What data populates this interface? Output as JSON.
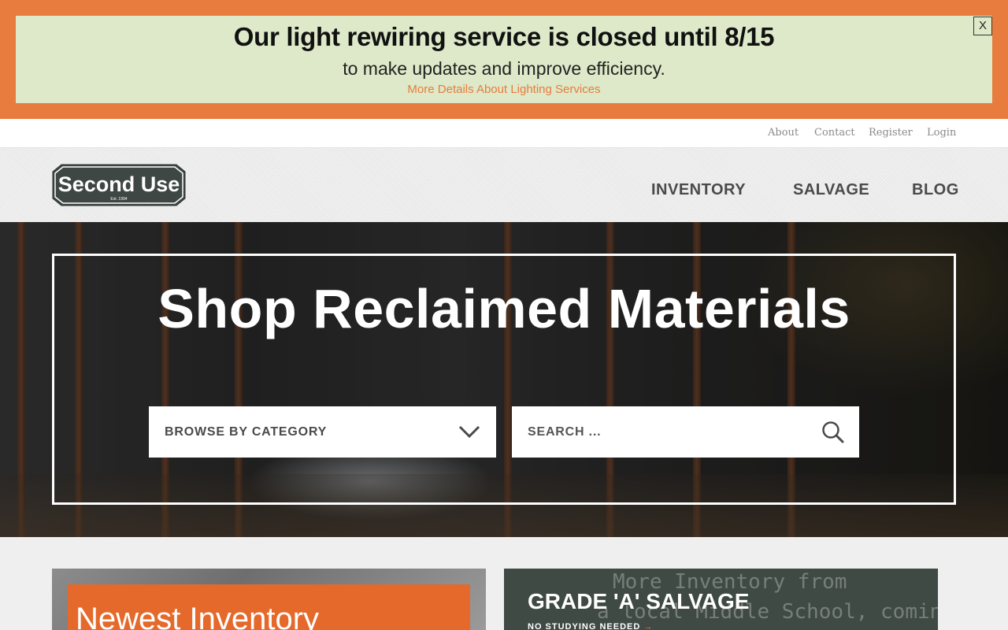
{
  "alert": {
    "title": "Our light rewiring service is closed until 8/15",
    "subtitle": "to make updates and improve efficiency.",
    "link": "More Details About Lighting Services",
    "close_label": "X"
  },
  "utility_nav": [
    "About",
    "Contact",
    "Register",
    "Login"
  ],
  "brand": {
    "logo_text": "Second Use",
    "logo_tagline": "Est. 1994"
  },
  "main_nav": [
    "INVENTORY",
    "SALVAGE",
    "BLOG"
  ],
  "hero": {
    "title": "Shop Reclaimed Materials",
    "category_select": "BROWSE BY CATEGORY",
    "search_placeholder": "SEARCH ..."
  },
  "cards": {
    "left_title": "Newest Inventory",
    "right_title": "GRADE 'A' SALVAGE",
    "right_subtitle": "NO STUDYING NEEDED",
    "chalkboard_line1": "More Inventory from",
    "chalkboard_line2": "a local Middle School, coming soon!"
  },
  "colors": {
    "accent_orange": "#e87b3e",
    "alert_bg": "#dde9c8",
    "nav_text": "#4a4a4a",
    "logo_bg": "#3e4744"
  }
}
